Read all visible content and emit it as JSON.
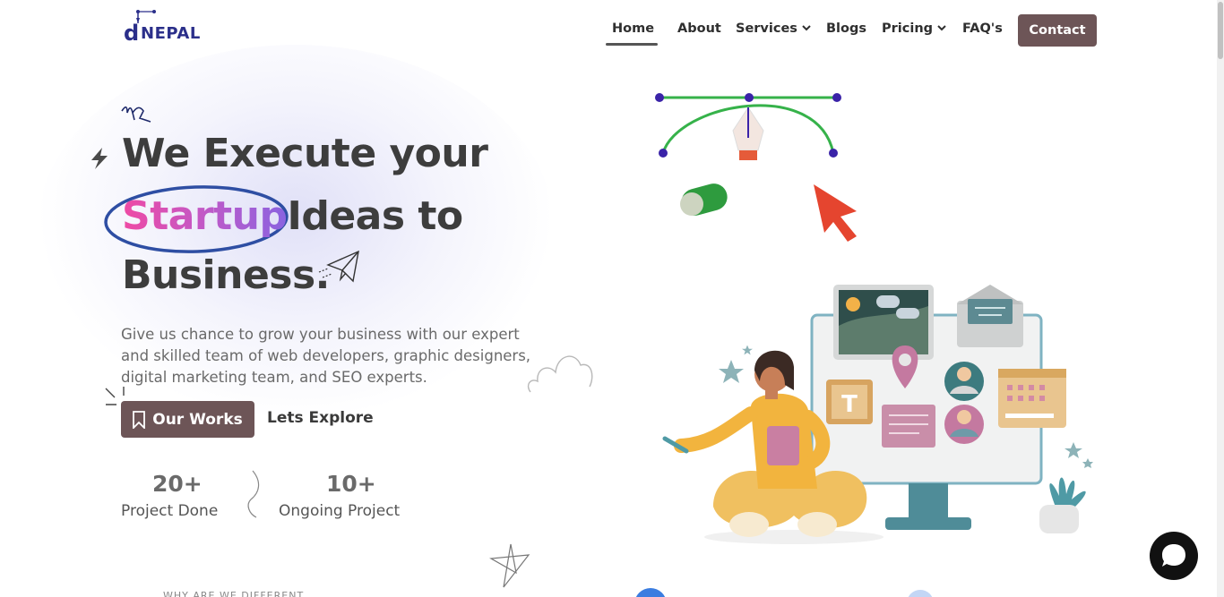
{
  "brand": {
    "logo_letter": "d",
    "logo_text": "NEPAL"
  },
  "nav": {
    "items": [
      {
        "label": "Home",
        "active": true
      },
      {
        "label": "About"
      },
      {
        "label": "Services",
        "dropdown": true
      },
      {
        "label": "Blogs"
      },
      {
        "label": "Pricing",
        "dropdown": true
      },
      {
        "label": "FAQ's"
      }
    ],
    "contact_label": "Contact"
  },
  "hero": {
    "line1": "We Execute your",
    "line2_highlight": "Startup",
    "line2_rest": "Ideas to",
    "line3": "Business.",
    "description": "Give us chance to grow your business with our expert and skilled team of web developers, graphic designers, digital marketing team, and SEO experts.",
    "primary_button": "Our Works",
    "secondary_link": "Lets Explore"
  },
  "stats": [
    {
      "value": "20+",
      "label": "Project Done"
    },
    {
      "value": "10+",
      "label": "Ongoing Project"
    }
  ],
  "section_peek": "WHY ARE WE DIFFERENT",
  "colors": {
    "brand_navy": "#2b2f8a",
    "button_brown": "#6d5557",
    "gradient_pink": "#ef4aa4",
    "gradient_purple": "#8a63e0",
    "circle_blue": "#2e4ea3"
  },
  "icons": [
    "bolt-icon",
    "bookmark-icon",
    "chevron-down-icon",
    "chat-icon",
    "paper-plane-icon"
  ]
}
